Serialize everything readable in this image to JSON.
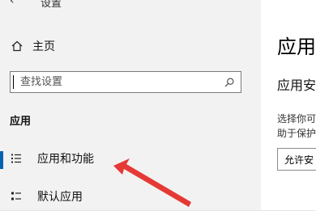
{
  "window": {
    "title": "设置",
    "back_icon": "back-arrow-icon"
  },
  "sidebar": {
    "home": {
      "label": "主页",
      "icon": "home-icon"
    },
    "search": {
      "placeholder": "查找设置",
      "icon": "search-icon"
    },
    "section": "应用",
    "items": [
      {
        "label": "应用和功能",
        "icon": "apps-list-icon",
        "selected": true
      },
      {
        "label": "默认应用",
        "icon": "default-apps-icon",
        "selected": false
      }
    ]
  },
  "content": {
    "heading": "应用和",
    "subheading": "应用安",
    "desc_line1": "选择你可",
    "desc_line2": "助于保护",
    "select_value": "允许安"
  },
  "colors": {
    "accent": "#0063b1",
    "annotation_arrow": "#e53935"
  }
}
